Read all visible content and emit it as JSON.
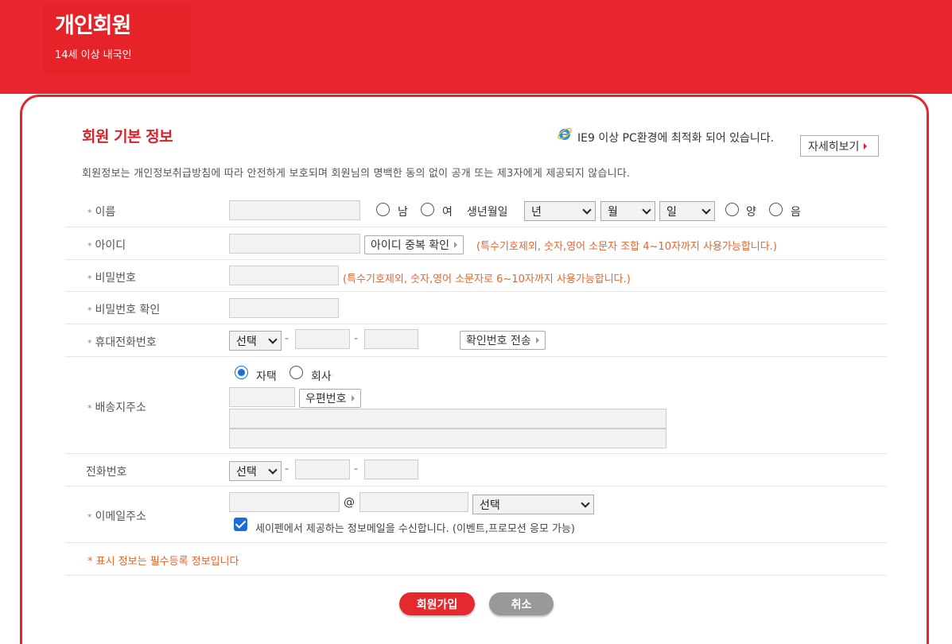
{
  "header": {
    "title": "개인회원",
    "subtitle": "14세 이상 내국인"
  },
  "section": {
    "title": "회원 기본 정보",
    "browser_notice": "IE9 이상 PC환경에 최적화 되어 있습니다.",
    "detail_button": "자세히보기",
    "privacy_notice": "회원정보는 개인정보취급방침에 따라 안전하게 보호되며 회원님의 명백한 동의 없이 공개 또는 제3자에게 제공되지 않습니다."
  },
  "form": {
    "name": {
      "label": "이름",
      "gender_male": "남",
      "gender_female": "여",
      "birth_label": "생년월일",
      "year": "년",
      "month": "월",
      "day": "일",
      "solar": "양",
      "lunar": "음"
    },
    "id": {
      "label": "아이디",
      "check_button": "아이디 중복 확인",
      "hint": "(특수기호제외, 숫자,영어 소문자 조합 4~10자까지 사용가능합니다.)"
    },
    "password": {
      "label": "비밀번호",
      "hint": "(특수기호제외, 숫자,영어 소문자로 6~10자까지 사용가능합니다.)"
    },
    "password_confirm": {
      "label": "비밀번호 확인"
    },
    "mobile": {
      "label": "휴대전화번호",
      "select": "선택",
      "dash": "-",
      "send_button": "확인번호 전송"
    },
    "address": {
      "label": "배송지주소",
      "home": "자택",
      "company": "회사",
      "zip_button": "우편번호"
    },
    "phone": {
      "label": "전화번호",
      "select": "선택",
      "dash": "-"
    },
    "email": {
      "label": "이메일주소",
      "at": "@",
      "domain_select": "선택",
      "consent": "세이펜에서 제공하는 정보메일을 수신합니다. (이벤트,프로모션 응모 가능)"
    },
    "required_star": "*",
    "required_note": "* 표시 정보는 필수등록 정보입니다"
  },
  "buttons": {
    "join": "회원가입",
    "cancel": "취소"
  },
  "colors": {
    "brand_red": "#e8262d",
    "hint_orange": "#e8642a",
    "radio_blue": "#1a6ed8"
  }
}
